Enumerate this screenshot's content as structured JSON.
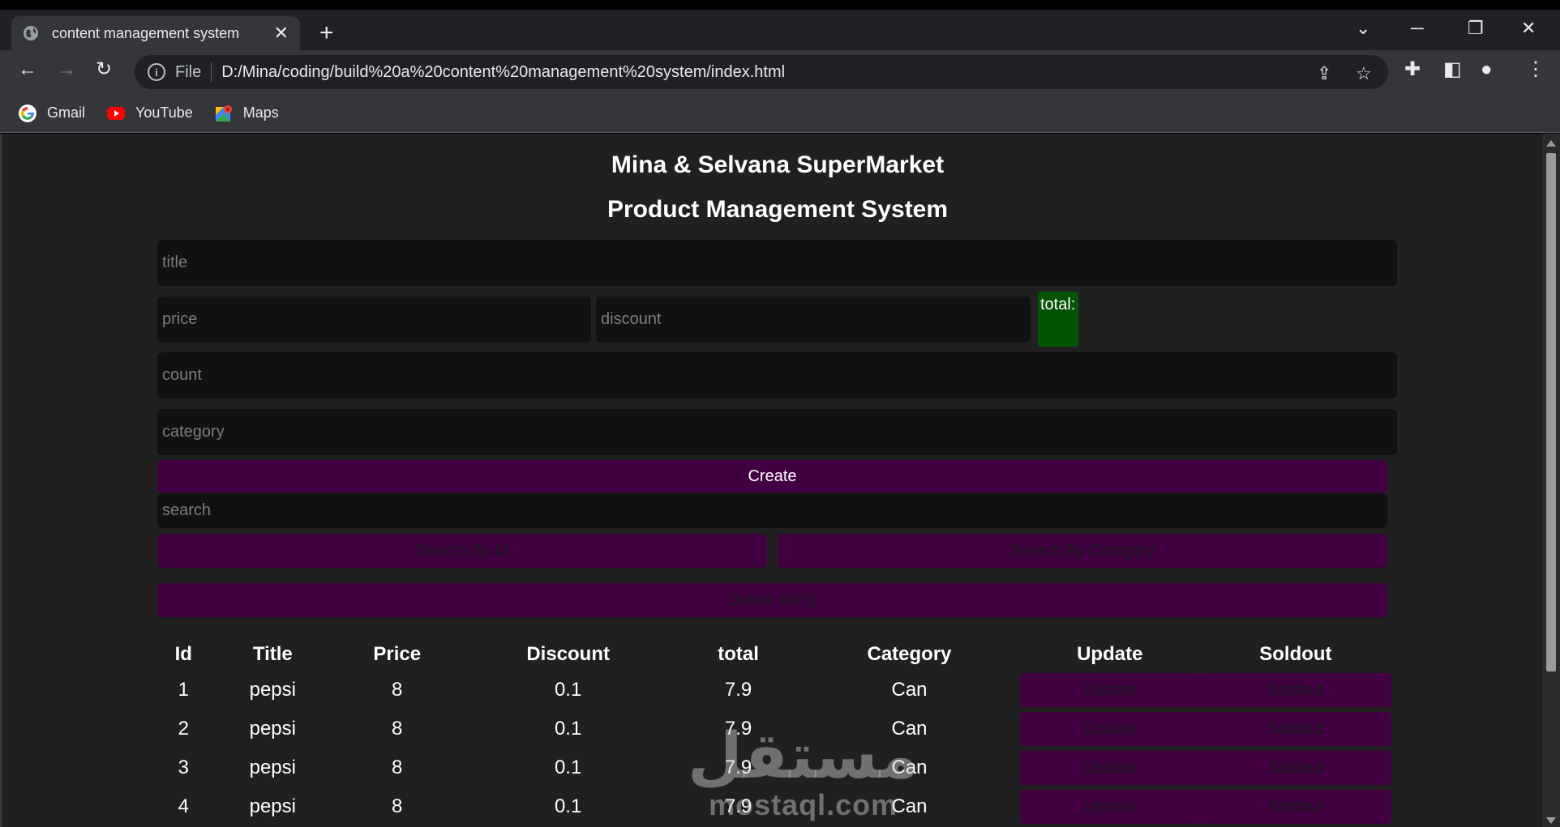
{
  "browser": {
    "tab_title": "content management system",
    "address": {
      "scheme_label": "File",
      "url": "D:/Mina/coding/build%20a%20content%20management%20system/index.html"
    },
    "bookmarks": [
      {
        "label": "Gmail",
        "icon": "google-icon"
      },
      {
        "label": "YouTube",
        "icon": "youtube-icon"
      },
      {
        "label": "Maps",
        "icon": "maps-icon"
      }
    ]
  },
  "app": {
    "store_name": "Mina & Selvana SuperMarket",
    "system_name": "Product Management System",
    "form": {
      "title_placeholder": "title",
      "price_placeholder": "price",
      "discount_placeholder": "discount",
      "total_label": "total:",
      "count_placeholder": "count",
      "category_placeholder": "category",
      "create_label": "Create",
      "search_placeholder": "search",
      "search_by_id_label": "Search By Id",
      "search_by_category_label": "Search By Catogary",
      "delete_all_label": "Delete All(5)"
    },
    "table": {
      "headers": [
        "Id",
        "Title",
        "Price",
        "Discount",
        "total",
        "Category",
        "Update",
        "Soldout"
      ],
      "update_label": "Update",
      "soldout_label": "Soldout",
      "rows": [
        {
          "id": "1",
          "title": "pepsi",
          "price": "8",
          "discount": "0.1",
          "total": "7.9",
          "category": "Can"
        },
        {
          "id": "2",
          "title": "pepsi",
          "price": "8",
          "discount": "0.1",
          "total": "7.9",
          "category": "Can"
        },
        {
          "id": "3",
          "title": "pepsi",
          "price": "8",
          "discount": "0.1",
          "total": "7.9",
          "category": "Can"
        },
        {
          "id": "4",
          "title": "pepsi",
          "price": "8",
          "discount": "0.1",
          "total": "7.9",
          "category": "Can"
        }
      ]
    }
  },
  "watermark": {
    "arabic": "مستقل",
    "latin": "mostaql.com"
  },
  "colors": {
    "button_purple": "#420042",
    "total_green": "#045304",
    "input_bg": "#111111",
    "page_bg": "#202020"
  }
}
